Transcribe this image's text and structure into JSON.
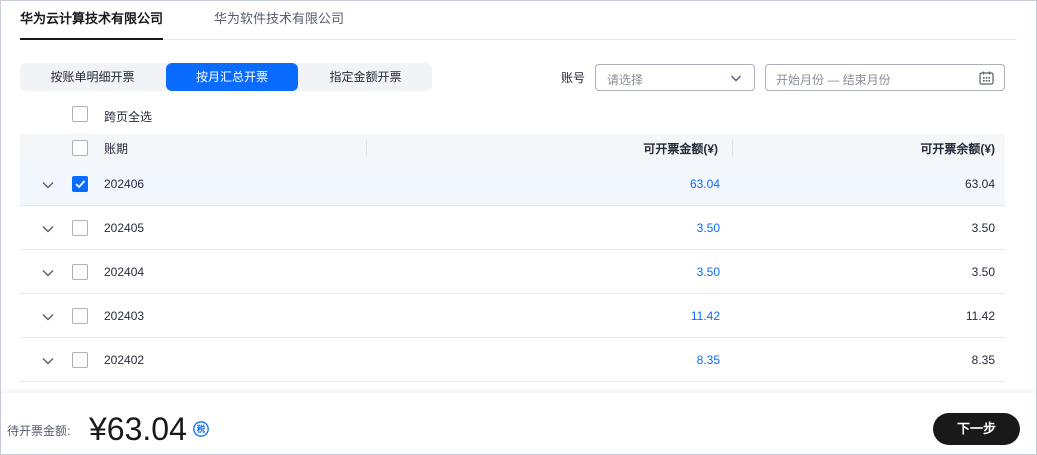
{
  "company_tabs": [
    {
      "label": "华为云计算技术有限公司",
      "active": true
    },
    {
      "label": "华为软件技术有限公司",
      "active": false
    }
  ],
  "modes": [
    {
      "label": "按账单明细开票",
      "active": false
    },
    {
      "label": "按月汇总开票",
      "active": true
    },
    {
      "label": "指定金额开票",
      "active": false
    }
  ],
  "filters": {
    "account_label": "账号",
    "account_placeholder": "请选择",
    "date_placeholder": "开始月份 — 结束月份"
  },
  "select_all_pages_label": "跨页全选",
  "table": {
    "headers": {
      "period": "账期",
      "amount": "可开票金额(¥)",
      "remaining": "可开票余额(¥)"
    },
    "rows": [
      {
        "period": "202406",
        "amount": "63.04",
        "remaining": "63.04",
        "checked": true
      },
      {
        "period": "202405",
        "amount": "3.50",
        "remaining": "3.50",
        "checked": false
      },
      {
        "period": "202404",
        "amount": "3.50",
        "remaining": "3.50",
        "checked": false
      },
      {
        "period": "202403",
        "amount": "11.42",
        "remaining": "11.42",
        "checked": false
      },
      {
        "period": "202402",
        "amount": "8.35",
        "remaining": "8.35",
        "checked": false
      }
    ]
  },
  "footer": {
    "pending_label": "待开票金额:",
    "pending_amount": "¥63.04",
    "tax_icon_text": "税",
    "next_label": "下一步"
  },
  "colors": {
    "accent": "#0a6cff",
    "dark_button": "#191919",
    "selected_row": "#f2f6fd"
  }
}
